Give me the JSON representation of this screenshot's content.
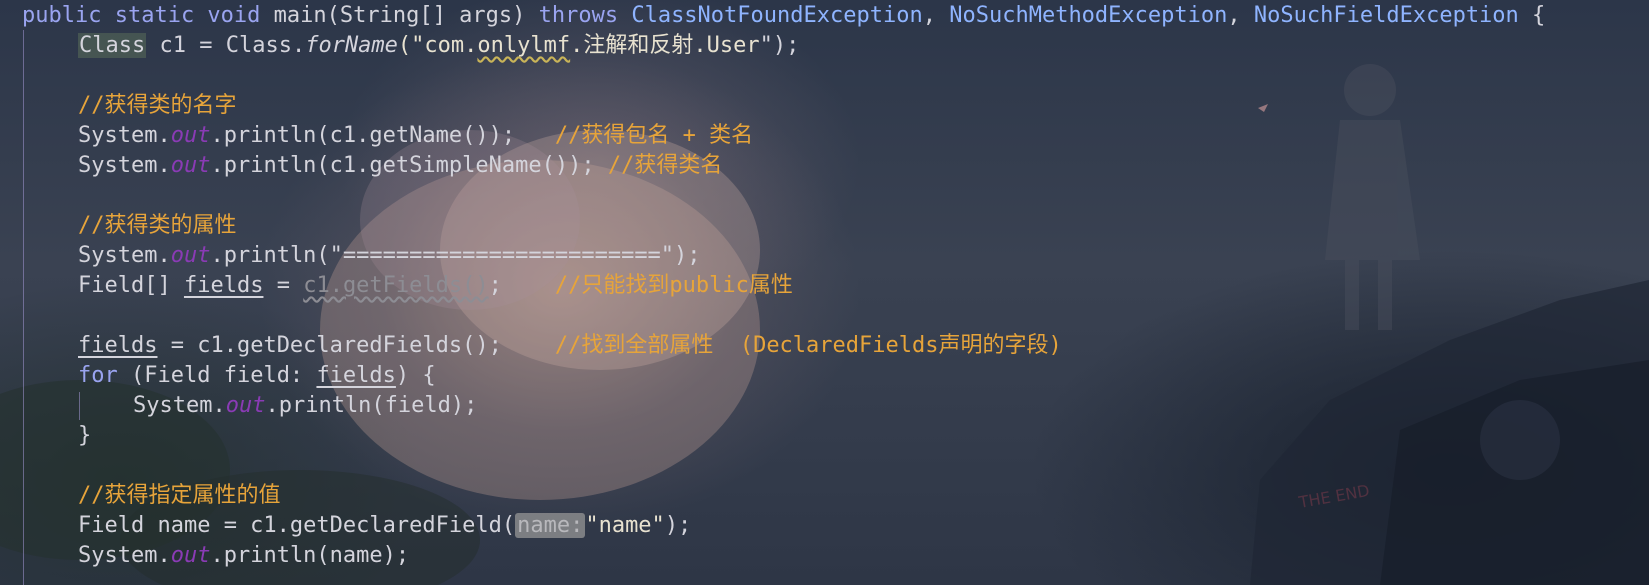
{
  "code": {
    "method_signature": {
      "modifiers": "public static void",
      "method_name": "main",
      "params": "(String[] args)",
      "throws_kw": "throws",
      "exceptions": [
        "ClassNotFoundException",
        "NoSuchMethodException",
        "NoSuchFieldException"
      ],
      "open_brace": "{"
    },
    "lines": {
      "l2": {
        "type": "Class",
        "mid": " c1 = ",
        "cls": "Class",
        "dot": ".",
        "method": "forName",
        "open": "(\"",
        "pkg1": "com.",
        "pkg2": "onlylmf",
        "pkg3": ".注解和反射.User",
        "close": "\");"
      },
      "l4": {
        "comment": "//获得类的名字"
      },
      "l5": {
        "prefix": "System.",
        "out": "out",
        "call": ".println(c1.getName());",
        "gap": "   ",
        "comment": "//获得包名 + 类名"
      },
      "l6": {
        "prefix": "System.",
        "out": "out",
        "call": ".println(c1.getSimpleName());",
        "gap": " ",
        "comment": "//获得类名"
      },
      "l8": {
        "comment": "//获得类的属性"
      },
      "l9": {
        "prefix": "System.",
        "out": "out",
        "call": ".println(\"========================\");"
      },
      "l10": {
        "type": "Field[] ",
        "var": "fields",
        "eq": " = ",
        "deprecated": "c1.getFields()",
        "end": ";",
        "gap": "    ",
        "comment": "//只能找到public属性"
      },
      "l12": {
        "var": "fields",
        "rest": " = c1.getDeclaredFields();",
        "gap": "    ",
        "comment": "//找到全部属性  (DeclaredFields声明的字段)"
      },
      "l13": {
        "kw": "for",
        "head": " (Field field: ",
        "var": "fields",
        "tail": ") {"
      },
      "l14": {
        "prefix": "System.",
        "out": "out",
        "call": ".println(field);"
      },
      "l15": {
        "brace": "}"
      },
      "l17": {
        "comment": "//获得指定属性的值"
      },
      "l18": {
        "head": "Field name = c1.getDeclaredField(",
        "hint": "name:",
        "arg": "\"name\"",
        "tail": ");"
      },
      "l19": {
        "prefix": "System.",
        "out": "out",
        "call": ".println(name);"
      }
    }
  },
  "colors": {
    "keyword": "#9aa4f0",
    "comment": "#e7a43a",
    "static_field": "#8a3bb5",
    "text": "#d4d4dc"
  },
  "background_art": {
    "description_icon": "anime-sky-wallpaper"
  }
}
